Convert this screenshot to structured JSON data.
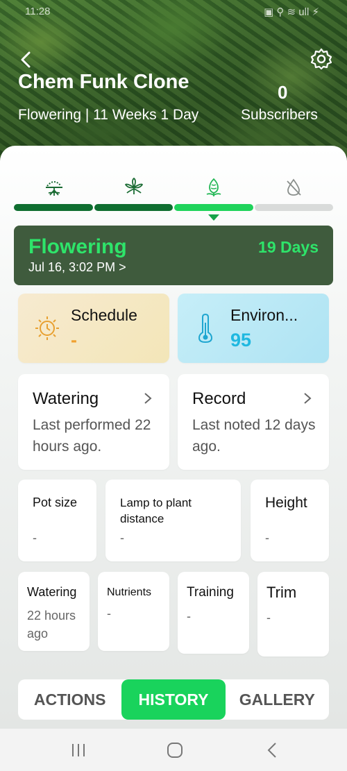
{
  "status_bar": {
    "time": "11:28",
    "right_icons": "▣ ⚲ ≋ ull ⚡"
  },
  "header": {
    "title": "Chem Funk Clone",
    "subtitle": "Flowering | 11 Weeks 1 Day",
    "subscribers_count": "0",
    "subscribers_label": "Subscribers"
  },
  "stages": [
    "germination-icon",
    "vegetative-icon",
    "flowering-icon",
    "drying-icon"
  ],
  "progress": {
    "colors": [
      "#0f6e30",
      "#0f6e30",
      "#1fd35b",
      "#d9dbda"
    ]
  },
  "current_stage": {
    "name": "Flowering",
    "days": "19 Days",
    "date": "Jul 16, 3:02 PM >"
  },
  "schedule": {
    "label": "Schedule",
    "value": "-"
  },
  "environment": {
    "label": "Environ...",
    "value": "95"
  },
  "watering_card": {
    "label": "Watering",
    "desc": "Last performed 22 hours ago."
  },
  "record_card": {
    "label": "Record",
    "desc": "Last noted 12 days ago."
  },
  "stats_row1": [
    {
      "label": "Pot size",
      "value": "-"
    },
    {
      "label": "Lamp to plant distance",
      "value": "-"
    },
    {
      "label": "Height",
      "value": "-"
    }
  ],
  "stats_row2": [
    {
      "label": "Watering",
      "value": "22 hours ago"
    },
    {
      "label": "Nutrients",
      "value": "-"
    },
    {
      "label": "Training",
      "value": "-"
    },
    {
      "label": "Trim",
      "value": "-"
    }
  ],
  "tabs": [
    "ACTIONS",
    "HISTORY",
    "GALLERY"
  ],
  "colors": {
    "accent": "#19d35c",
    "stage_bg": "#3f5b3d",
    "orange": "#f0a030",
    "cyan": "#1fb8e0"
  }
}
